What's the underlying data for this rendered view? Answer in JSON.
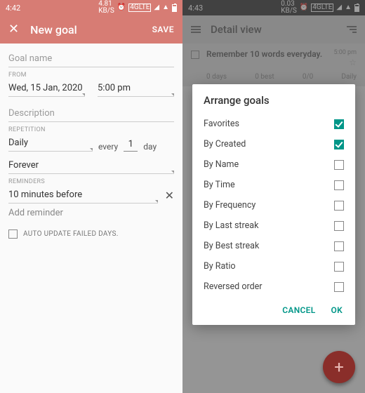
{
  "left": {
    "status_time": "4:42",
    "appbar": {
      "title": "New goal",
      "save": "SAVE"
    },
    "goal_name_placeholder": "Goal name",
    "from_label": "FROM",
    "date": "Wed, 15 Jan, 2020",
    "time": "5:00 pm",
    "description_placeholder": "Description",
    "repetition_label": "REPETITION",
    "repetition_value": "Daily",
    "every_text": "every",
    "every_num": "1",
    "every_unit": "day",
    "forever": "Forever",
    "reminders_label": "REMINDERS",
    "reminder_value": "10 minutes before",
    "add_reminder": "Add reminder",
    "auto_update": "AUTO UPDATE FAILED DAYS."
  },
  "right": {
    "status_time": "4:43",
    "appbar_title": "Detail view",
    "goal": {
      "title": "Remember 10 words everyday.",
      "time": "5:00 pm",
      "stats": {
        "days": "0 days",
        "best": "0 best",
        "ratio": "0/0",
        "freq": "Daily"
      }
    },
    "dialog": {
      "title": "Arrange goals",
      "options": [
        {
          "label": "Favorites",
          "checked": true
        },
        {
          "label": "By Created",
          "checked": true
        },
        {
          "label": "By Name",
          "checked": false
        },
        {
          "label": "By Time",
          "checked": false
        },
        {
          "label": "By Frequency",
          "checked": false
        },
        {
          "label": "By Last streak",
          "checked": false
        },
        {
          "label": "By Best streak",
          "checked": false
        },
        {
          "label": "By Ratio",
          "checked": false
        },
        {
          "label": "Reversed order",
          "checked": false
        }
      ],
      "cancel": "CANCEL",
      "ok": "OK"
    }
  }
}
